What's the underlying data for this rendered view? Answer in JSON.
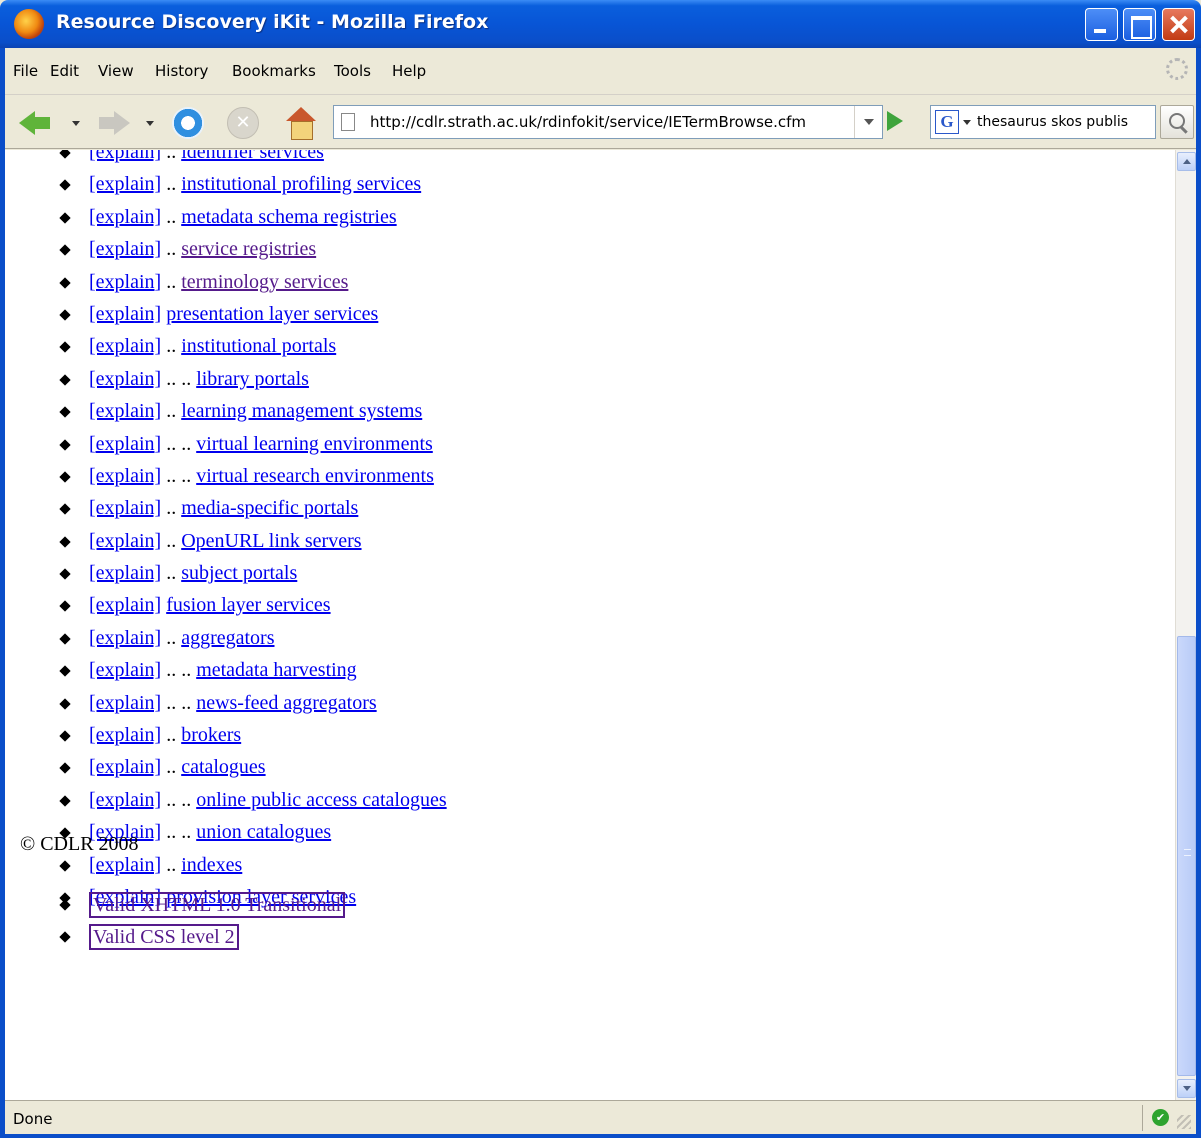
{
  "window": {
    "title": "Resource Discovery iKit - Mozilla Firefox"
  },
  "menu": {
    "items": [
      "File",
      "Edit",
      "View",
      "History",
      "Bookmarks",
      "Tools",
      "Help"
    ]
  },
  "navbar": {
    "url": "http://cdlr.strath.ac.uk/rdinfokit/service/IETermBrowse.cfm",
    "search_engine": "G",
    "search_query": "thesaurus skos publis"
  },
  "content": {
    "explain_label": "[explain]",
    "items": [
      {
        "prefix": "..",
        "term": "identifier services",
        "visited": false
      },
      {
        "prefix": "..",
        "term": "institutional profiling services",
        "visited": false
      },
      {
        "prefix": "..",
        "term": "metadata schema registries",
        "visited": false
      },
      {
        "prefix": "..",
        "term": "service registries",
        "visited": true
      },
      {
        "prefix": "..",
        "term": "terminology services",
        "visited": true
      },
      {
        "prefix": "",
        "term": "presentation layer services",
        "visited": false
      },
      {
        "prefix": "..",
        "term": "institutional portals",
        "visited": false
      },
      {
        "prefix": ".. ..",
        "term": "library portals",
        "visited": false
      },
      {
        "prefix": "..",
        "term": "learning management systems",
        "visited": false
      },
      {
        "prefix": ".. ..",
        "term": "virtual learning environments",
        "visited": false
      },
      {
        "prefix": ".. ..",
        "term": "virtual research environments",
        "visited": false
      },
      {
        "prefix": "..",
        "term": "media-specific portals",
        "visited": false
      },
      {
        "prefix": "..",
        "term": "OpenURL link servers",
        "visited": false
      },
      {
        "prefix": "..",
        "term": "subject portals",
        "visited": false
      },
      {
        "prefix": "",
        "term": "fusion layer services",
        "visited": false
      },
      {
        "prefix": "..",
        "term": "aggregators",
        "visited": false
      },
      {
        "prefix": ".. ..",
        "term": "metadata harvesting",
        "visited": false
      },
      {
        "prefix": ".. ..",
        "term": "news-feed aggregators",
        "visited": false
      },
      {
        "prefix": "..",
        "term": "brokers",
        "visited": false
      },
      {
        "prefix": "..",
        "term": "catalogues",
        "visited": false
      },
      {
        "prefix": ".. ..",
        "term": "online public access catalogues",
        "visited": false
      },
      {
        "prefix": ".. ..",
        "term": "union catalogues",
        "visited": false
      },
      {
        "prefix": "..",
        "term": "indexes",
        "visited": false
      },
      {
        "prefix": "",
        "term": "provision layer services",
        "visited": false
      }
    ],
    "copyright": "© CDLR 2008",
    "validation_links": [
      "Valid XHTML 1.0 Transitional",
      "Valid CSS level 2"
    ]
  },
  "statusbar": {
    "text": "Done"
  },
  "colors": {
    "link": "#0000ee",
    "visited_link": "#551a8b",
    "titlebar": "#0a55d6"
  }
}
